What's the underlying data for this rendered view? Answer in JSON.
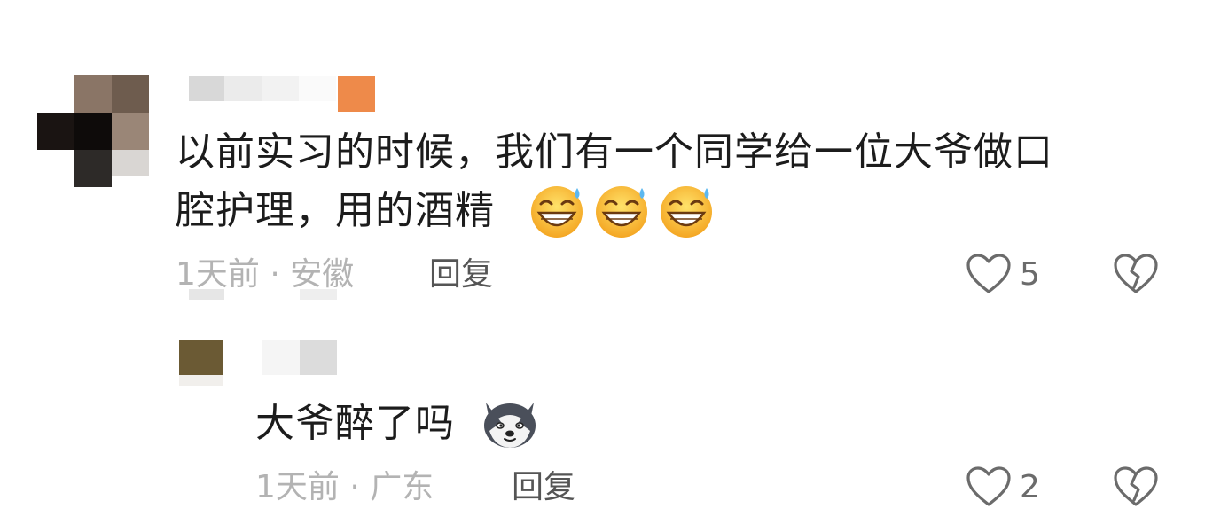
{
  "comments": [
    {
      "text_line1": "以前实习的时候，我们有一个同学给一位大爷做口",
      "text_line2": "腔护理，用的酒精",
      "emojis": [
        "grin-sweat-emoji",
        "grin-sweat-emoji",
        "grin-sweat-emoji"
      ],
      "time_location": "1天前 · 安徽",
      "reply_label": "回复",
      "like_count": "5",
      "replies": [
        {
          "text": "大爷醉了吗",
          "emoji": "husky-dog-emoji",
          "time_location": "1天前 · 广东",
          "reply_label": "回复",
          "like_count": "2"
        }
      ]
    }
  ],
  "colors": {
    "text": "#1c1c1c",
    "meta": "#b3b3b3",
    "reply": "#555555",
    "icon": "#6b6b6b"
  }
}
